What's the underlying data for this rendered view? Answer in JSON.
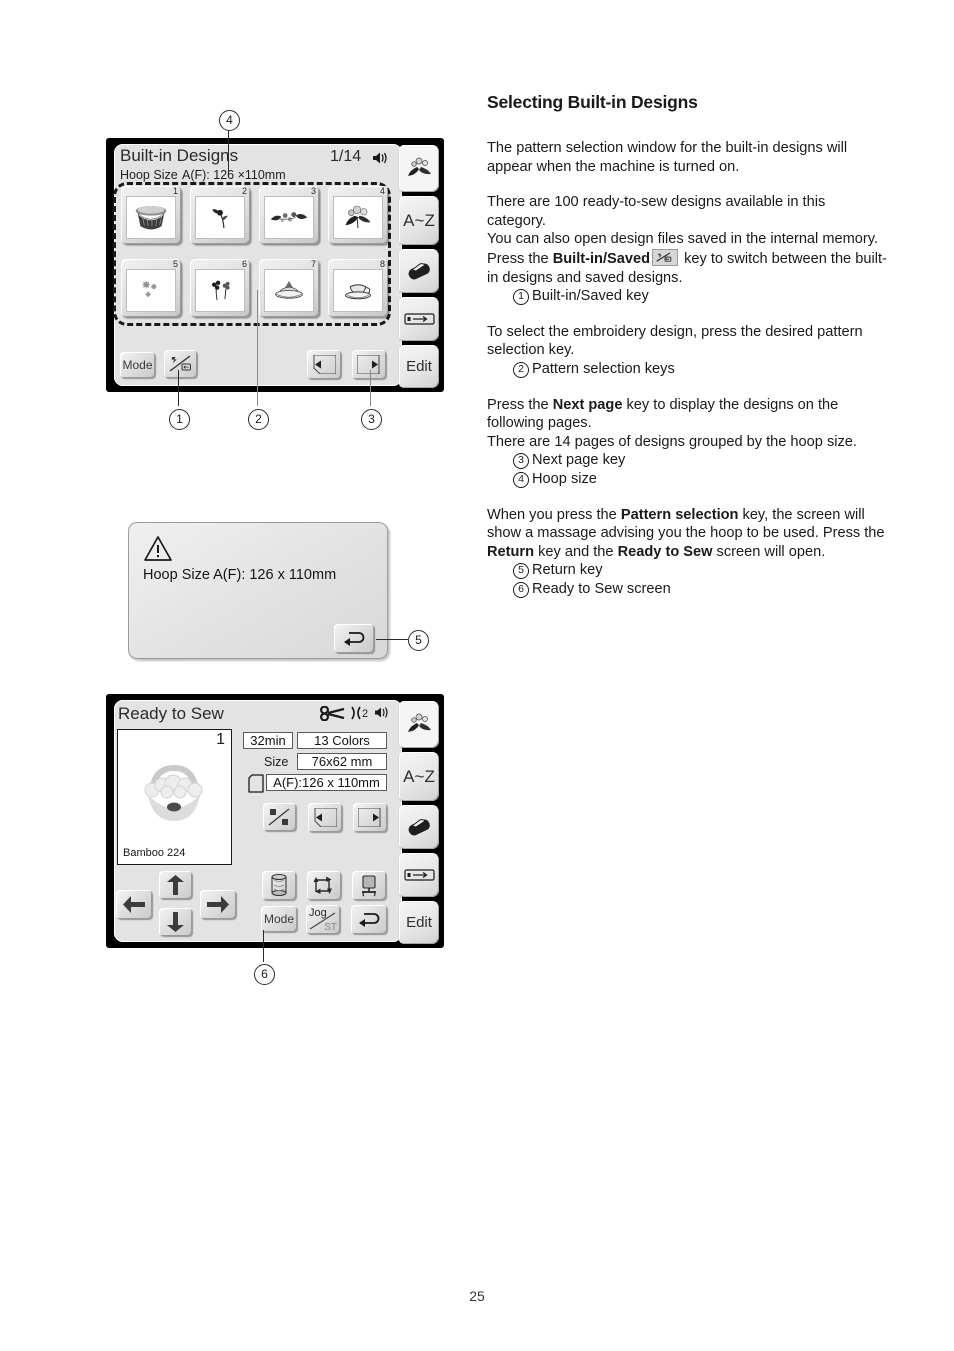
{
  "page_number": "25",
  "article": {
    "title": "Selecting Built-in Designs",
    "p1": "The pattern selection window for the built-in designs will appear when the machine is turned on.",
    "p2_a": "There are 100 ready-to-sew designs available in this category.",
    "p2_b": "You can also open design files saved in the internal memory.",
    "p2_c_pre": "Press the ",
    "p2_c_bold": "Built-in/Saved",
    "p2_c_post": " key to switch between the built-in designs and saved designs.",
    "item1": "Built-in/Saved key",
    "p3": "To select the embroidery design, press the desired pattern selection key.",
    "item2": "Pattern selection keys",
    "p4_pre": "Press the ",
    "p4_bold": "Next page",
    "p4_post": " key to display the designs on the following pages.",
    "p4_b": "There are 14 pages of designs grouped by the hoop size.",
    "item3": "Next page key",
    "item4": "Hoop size",
    "p5_pre": "When you press the ",
    "p5_bold": "Pattern selection",
    "p5_mid": " key, the screen will show a massage advising you the hoop to be used. Press the ",
    "p5_bold2": "Return",
    "p5_mid2": " key and the ",
    "p5_bold3": "Ready to Sew",
    "p5_post": " screen will open.",
    "item5": "Return key",
    "item6": "Ready to Sew screen"
  },
  "markers": {
    "m1": "1",
    "m2": "2",
    "m3": "3",
    "m4": "4",
    "m5": "5",
    "m6": "6"
  },
  "builtin_screen": {
    "title": "Built-in Designs",
    "hoop_label": "Hoop Size",
    "hoop_value": "A(F): 126 ×110mm",
    "page_count": "1/14",
    "mode_label": "Mode",
    "edit_label": "Edit",
    "az_label": "A~Z",
    "designs": [
      {
        "num": "1",
        "icon": "flower-basket"
      },
      {
        "num": "2",
        "icon": "single-flower"
      },
      {
        "num": "3",
        "icon": "flower-spray"
      },
      {
        "num": "4",
        "icon": "flower-bouquet"
      },
      {
        "num": "5",
        "icon": "small-blossoms"
      },
      {
        "num": "6",
        "icon": "two-flowers"
      },
      {
        "num": "7",
        "icon": "cake-plate"
      },
      {
        "num": "8",
        "icon": "tea-cup"
      }
    ]
  },
  "dialog": {
    "message": "Hoop Size A(F): 126 x 110mm",
    "return_icon": "return-arrow-icon",
    "warning_icon": "warning-triangle-icon"
  },
  "ready_screen": {
    "title": "Ready to Sew",
    "design_number": "1",
    "design_name": "Bamboo 224",
    "time": "32min",
    "colors": "13 Colors",
    "size_label": "Size",
    "size_value": "76x62 mm",
    "hoop_value": "A(F):126 x 110mm",
    "mode_label": "Mode",
    "jog_label": "Jog",
    "jog_sub": "ST",
    "edit_label": "Edit",
    "az_label": "A~Z",
    "header_icons": [
      "scissors-icon",
      "bobbin-thread-icon",
      "speaker-icon"
    ]
  },
  "colors": {
    "screen_bezel": "#000000",
    "screen_bg": "#e3e3e3",
    "key_face": "#e0e0e0",
    "text": "#1a1a1a"
  }
}
